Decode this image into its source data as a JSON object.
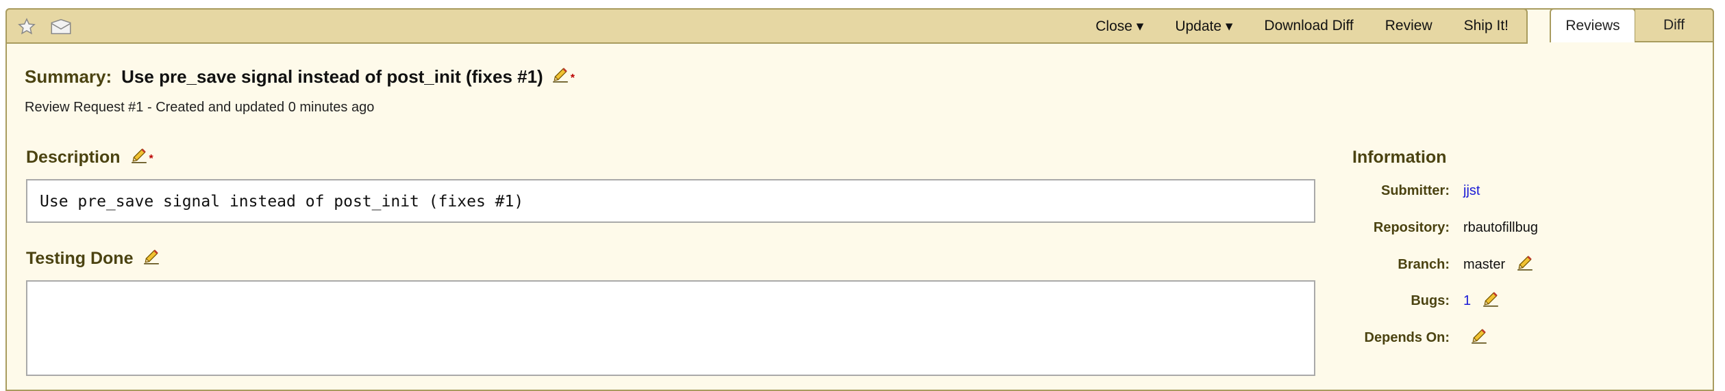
{
  "toolbar": {
    "actions": [
      {
        "label": "Close ▾"
      },
      {
        "label": "Update ▾"
      },
      {
        "label": "Download Diff"
      },
      {
        "label": "Review"
      },
      {
        "label": "Ship It!"
      }
    ]
  },
  "tabs": {
    "reviews": "Reviews",
    "diff": "Diff"
  },
  "summary": {
    "label": "Summary:",
    "value": "Use pre_save signal instead of post_init (fixes #1)"
  },
  "subtitle": "Review Request #1 - Created and updated 0 minutes ago",
  "description": {
    "heading": "Description",
    "text": "Use pre_save signal instead of post_init (fixes #1)"
  },
  "testing": {
    "heading": "Testing Done",
    "text": ""
  },
  "required_marker": "*",
  "info": {
    "title": "Information",
    "submitter_label": "Submitter:",
    "submitter": "jjst",
    "repository_label": "Repository:",
    "repository": "rbautofillbug",
    "branch_label": "Branch:",
    "branch": "master",
    "bugs_label": "Bugs:",
    "bugs": "1",
    "depends_label": "Depends On:",
    "depends": ""
  },
  "icons": {
    "star": "star-icon",
    "mail": "mail-icon",
    "edit": "pencil-icon"
  },
  "colors": {
    "header_bg": "#e6d7a3",
    "page_bg": "#fefaea",
    "border": "#a89b5e",
    "heading": "#4b4311",
    "link": "#1a1ad6",
    "required": "#bb0000"
  }
}
